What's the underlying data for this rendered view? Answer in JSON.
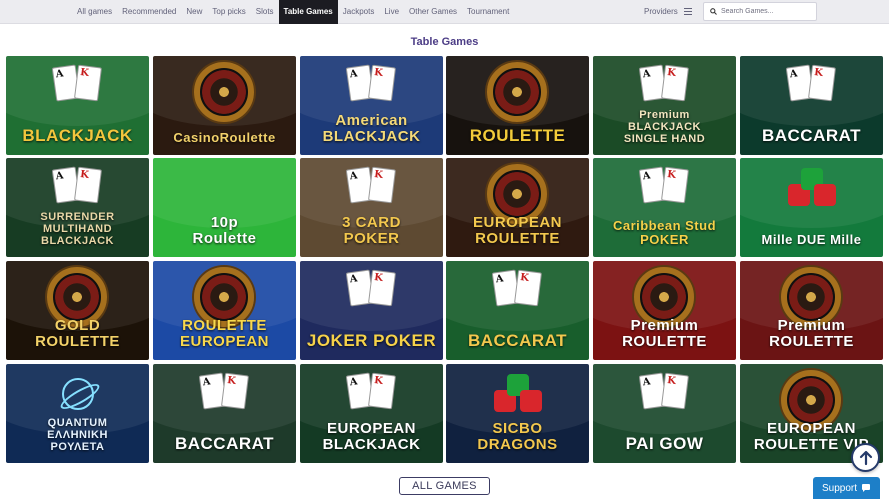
{
  "nav": {
    "items": [
      "All games",
      "Recommended",
      "New",
      "Top picks",
      "Slots",
      "Table Games",
      "Jackpots",
      "Live",
      "Other Games",
      "Tournament"
    ],
    "active": "Table Games"
  },
  "providers_label": "Providers",
  "search": {
    "placeholder": "Search Games..."
  },
  "section_title": "Table Games",
  "games": [
    {
      "title": "BLACKJACK",
      "bg": "#1f6f33",
      "text": "#f3c63d",
      "deco": "cards"
    },
    {
      "title": "CasinoRoulette",
      "bg": "#2b1a10",
      "text": "#f2d16b",
      "deco": "wheel"
    },
    {
      "title": "American\nBLACKJACK",
      "bg": "#1d3a78",
      "text": "#f4d978",
      "deco": "cards"
    },
    {
      "title": "ROULETTE",
      "bg": "#17120e",
      "text": "#f3cc3a",
      "deco": "wheel"
    },
    {
      "title": "Premium\nBLACKJACK\nSINGLE HAND",
      "bg": "#1b4b26",
      "text": "#f2e6c0",
      "deco": "cards"
    },
    {
      "title": "BACCARAT",
      "bg": "#0c3a2c",
      "text": "#ffffff",
      "deco": "cards"
    },
    {
      "title": "SURRENDER\nMULTIHAND\nBLACKJACK",
      "bg": "#173c23",
      "text": "#e9d8a8",
      "deco": "cards"
    },
    {
      "title": "10p\nRoulette",
      "bg": "#2db53a",
      "text": "#ffffff",
      "deco": "none"
    },
    {
      "title": "3 CARD\nPOKER",
      "bg": "#5e4a32",
      "text": "#f3c84e",
      "deco": "cards"
    },
    {
      "title": "EUROPEAN\nROULETTE",
      "bg": "#2f1a10",
      "text": "#f3c84e",
      "deco": "wheel"
    },
    {
      "title": "Caribbean Stud\nPOKER",
      "bg": "#1e6c38",
      "text": "#f6d24a",
      "deco": "cards"
    },
    {
      "title": "Mille DUE Mille",
      "bg": "#137a3c",
      "text": "#ffffff",
      "deco": "dice"
    },
    {
      "title": "GOLD\nROULETTE",
      "bg": "#1c1208",
      "text": "#f3d269",
      "deco": "wheel"
    },
    {
      "title": "ROULETTE\nEUROPEAN",
      "bg": "#1c4aa5",
      "text": "#f8d84c",
      "deco": "wheel"
    },
    {
      "title": "JOKER POKER",
      "bg": "#1f2a5e",
      "text": "#f6d24a",
      "deco": "cards"
    },
    {
      "title": "BACCARAT",
      "bg": "#185e2c",
      "text": "#f3c84e",
      "deco": "cards"
    },
    {
      "title": "Premium\nROULETTE",
      "bg": "#7c1212",
      "text": "#ffffff",
      "deco": "wheel"
    },
    {
      "title": "Premium\nROULETTE",
      "bg": "#6b1414",
      "text": "#ffffff",
      "deco": "wheel"
    },
    {
      "title": "QUANTUM\nΕΛΛΗΝΙΚΗ\nΡΟΥΛΕΤΑ",
      "bg": "#0f2a55",
      "text": "#e6f3ff",
      "deco": "logo"
    },
    {
      "title": "BACCARAT",
      "bg": "#1e3a2a",
      "text": "#ffffff",
      "deco": "cards"
    },
    {
      "title": "EUROPEAN\nBLACKJACK",
      "bg": "#143a24",
      "text": "#ffffff",
      "deco": "cards"
    },
    {
      "title": "SICBO\nDRAGONS",
      "bg": "#10213f",
      "text": "#f3c84e",
      "deco": "dice"
    },
    {
      "title": "PAI GOW",
      "bg": "#1d4a2e",
      "text": "#ffffff",
      "deco": "cards"
    },
    {
      "title": "EUROPEAN\nROULETTE VIP",
      "bg": "#1a4428",
      "text": "#ffffff",
      "deco": "wheel"
    }
  ],
  "all_games_label": "ALL GAMES",
  "support_label": "Support",
  "icons": {
    "search": "search-icon",
    "menu": "menu-icon",
    "scroll_up": "arrow-up-icon",
    "support": "chat-icon"
  }
}
